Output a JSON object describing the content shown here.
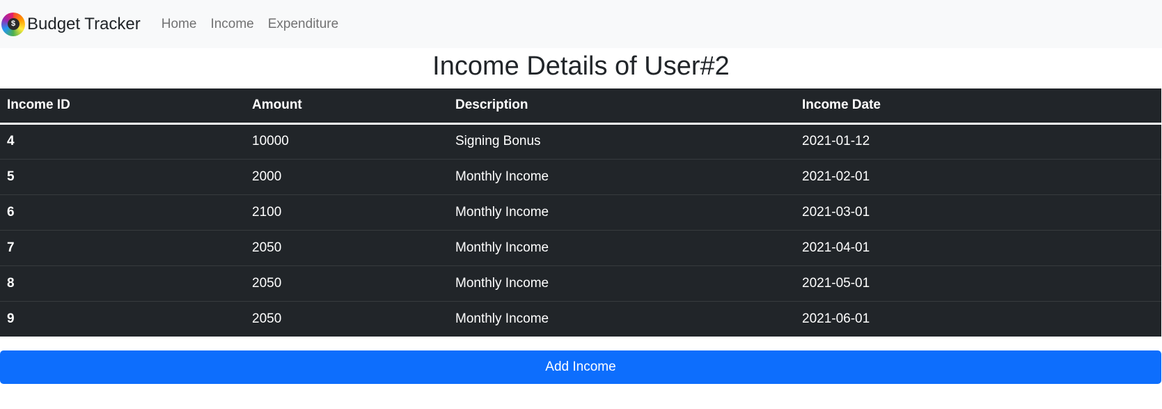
{
  "navbar": {
    "brand": "Budget Tracker",
    "logo_icon": "dollar-coin-icon",
    "links": [
      {
        "label": "Home"
      },
      {
        "label": "Income"
      },
      {
        "label": "Expenditure"
      }
    ],
    "background": "#f8f9fa"
  },
  "page": {
    "title": "Income Details of User#2"
  },
  "table": {
    "headers": [
      "Income ID",
      "Amount",
      "Description",
      "Income Date"
    ],
    "rows": [
      {
        "id": "4",
        "amount": "10000",
        "description": "Signing Bonus",
        "date": "2021-01-12"
      },
      {
        "id": "5",
        "amount": "2000",
        "description": "Monthly Income",
        "date": "2021-02-01"
      },
      {
        "id": "6",
        "amount": "2100",
        "description": "Monthly Income",
        "date": "2021-03-01"
      },
      {
        "id": "7",
        "amount": "2050",
        "description": "Monthly Income",
        "date": "2021-04-01"
      },
      {
        "id": "8",
        "amount": "2050",
        "description": "Monthly Income",
        "date": "2021-05-01"
      },
      {
        "id": "9",
        "amount": "2050",
        "description": "Monthly Income",
        "date": "2021-06-01"
      }
    ],
    "background": "#212529"
  },
  "actions": {
    "add_income_label": "Add Income",
    "accent": "#0d6efd"
  }
}
